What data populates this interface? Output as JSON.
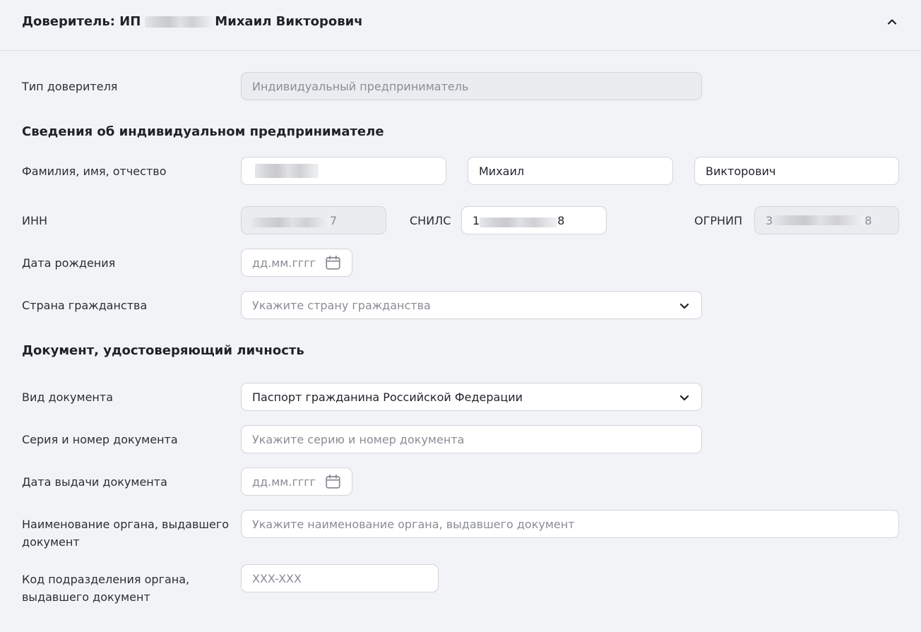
{
  "header": {
    "title_prefix": "Доверитель: ИП",
    "title_suffix": "Михаил Викторович",
    "collapse_icon": "chevron-up-icon"
  },
  "principal_type": {
    "label": "Тип доверителя",
    "value": "Индивидуальный предприниматель"
  },
  "entrepreneur": {
    "section_title": "Сведения об индивидуальном предпринимателе",
    "fio_label": "Фамилия, имя, отчество",
    "last_name": "",
    "first_name": "Михаил",
    "patronymic": "Викторович",
    "inn_label": "ИНН",
    "inn_visible_tail": "7",
    "snils_label": "СНИЛС",
    "snils_visible_head": "1",
    "snils_visible_tail": "8",
    "ogrnip_label": "ОГРНИП",
    "ogrnip_visible_head": "3",
    "ogrnip_visible_tail": "8",
    "birth_date_label": "Дата рождения",
    "birth_date_placeholder": "дд.мм.гггг",
    "citizenship_label": "Страна гражданства",
    "citizenship_placeholder": "Укажите страну гражданства"
  },
  "identity_document": {
    "section_title": "Документ, удостоверяющий личность",
    "doc_type_label": "Вид документа",
    "doc_type_value": "Паспорт гражданина Российской Федерации",
    "series_label": "Серия и номер документа",
    "series_placeholder": "Укажите серию и номер документа",
    "issue_date_label": "Дата выдачи документа",
    "issue_date_placeholder": "дд.мм.гггг",
    "issuer_label_line1": "Наименование органа, выдавшего",
    "issuer_label_line2": "документ",
    "issuer_placeholder": "Укажите наименование органа, выдавшего документ",
    "division_label_line1": "Код подразделения органа,",
    "division_label_line2": "выдавшего документ",
    "division_placeholder": "XXX-XXX"
  },
  "colors": {
    "background": "#f2f3f7",
    "field_border": "#d3d5db",
    "disabled_field": "#ebecf0",
    "placeholder_text": "#8a8d95"
  }
}
